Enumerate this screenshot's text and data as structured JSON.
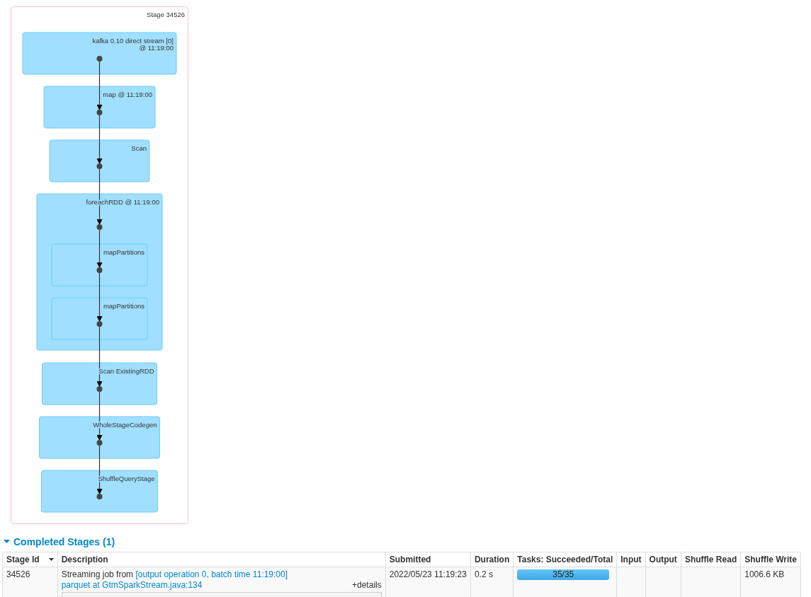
{
  "dag": {
    "stage_label": "Stage 34526",
    "nodes": [
      {
        "kind": "node",
        "lines": [
          "kafka 0.10 direct stream [0]",
          "@ 11:19:00"
        ]
      },
      {
        "kind": "node",
        "lines": [
          "map @ 11:19:00"
        ]
      },
      {
        "kind": "node",
        "lines": [
          "Scan"
        ]
      },
      {
        "kind": "cluster",
        "lines": [
          "foreachRDD @ 11:19:00"
        ],
        "children": [
          {
            "kind": "node",
            "lines": [
              "mapPartitions"
            ]
          },
          {
            "kind": "node",
            "lines": [
              "mapPartitions"
            ]
          }
        ]
      },
      {
        "kind": "node",
        "lines": [
          "Scan ExistingRDD"
        ]
      },
      {
        "kind": "node",
        "lines": [
          "WholeStageCodegen"
        ]
      },
      {
        "kind": "node",
        "lines": [
          "ShuffleQueryStage"
        ]
      }
    ]
  },
  "completed_stages": {
    "title": "Completed Stages (1)",
    "expanded": true,
    "columns": [
      {
        "label": "Stage Id",
        "sorted": true
      },
      {
        "label": "Description",
        "sorted": false
      },
      {
        "label": "Submitted",
        "sorted": false
      },
      {
        "label": "Duration",
        "sorted": false
      },
      {
        "label": "Tasks: Succeeded/Total",
        "sorted": false
      },
      {
        "label": "Input",
        "sorted": false
      },
      {
        "label": "Output",
        "sorted": false
      },
      {
        "label": "Shuffle Read",
        "sorted": false
      },
      {
        "label": "Shuffle Write",
        "sorted": false
      }
    ],
    "rows": [
      {
        "stage_id": "34526",
        "description_text": "Streaming job from",
        "description_link": "[output operation 0, batch time 11:19:00]",
        "call_site": "parquet at GtmSparkStream.java:134",
        "details_link": "+details",
        "submitted": "2022/05/23 11:19:23",
        "duration": "0.2 s",
        "tasks": {
          "label": "35/35",
          "level": 1
        },
        "input": "",
        "output": "",
        "shuffle_read": "",
        "shuffle_write": "1006.6 KB"
      }
    ]
  }
}
